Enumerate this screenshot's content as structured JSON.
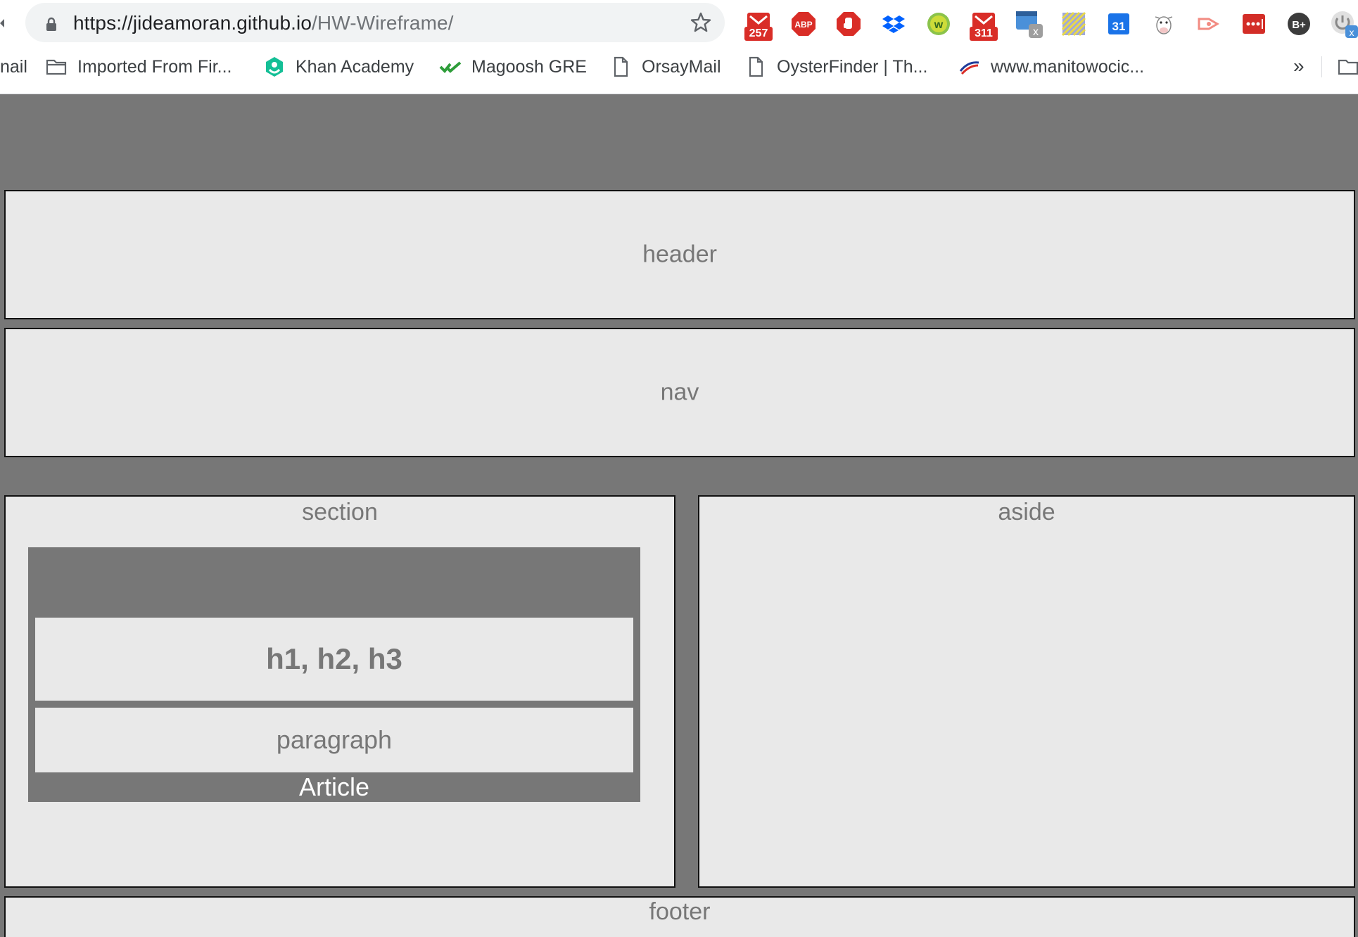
{
  "browser": {
    "url_host": "https://jideamoran.github.io",
    "url_path": "/HW-Wireframe/",
    "back_fragment": "⬅",
    "extensions": [
      {
        "name": "gmail-257",
        "badge": "257"
      },
      {
        "name": "adblock-plus",
        "label": "ABP"
      },
      {
        "name": "adblock-hand",
        "label": ""
      },
      {
        "name": "dropbox",
        "label": ""
      },
      {
        "name": "wordtune-w",
        "label": "w"
      },
      {
        "name": "gmail-311",
        "badge": "311"
      },
      {
        "name": "window-x",
        "label": "x"
      },
      {
        "name": "pattern-ext",
        "label": ""
      },
      {
        "name": "calendar-31",
        "label": "31"
      },
      {
        "name": "cow-ext",
        "label": ""
      },
      {
        "name": "cast-ext",
        "label": ""
      },
      {
        "name": "lastpass",
        "label": "•••|"
      },
      {
        "name": "b-plus",
        "label": "B+"
      },
      {
        "name": "power-x",
        "label": "x"
      }
    ],
    "bookmarks": [
      {
        "label": "nail",
        "icon": "none"
      },
      {
        "label": "Imported From Fir...",
        "icon": "folder-icon"
      },
      {
        "label": "Khan Academy",
        "icon": "khan-icon"
      },
      {
        "label": "Magoosh GRE",
        "icon": "magoosh-icon"
      },
      {
        "label": "OrsayMail",
        "icon": "page-icon"
      },
      {
        "label": "OysterFinder | Th...",
        "icon": "page-icon"
      },
      {
        "label": "www.manitowocic...",
        "icon": "swoosh-icon"
      }
    ],
    "more_label": "»"
  },
  "wireframe": {
    "header_label": "header",
    "nav_label": "nav",
    "section_label": "section",
    "aside_label": "aside",
    "headings_label": "h1, h2, h3",
    "paragraph_label": "paragraph",
    "article_label": "Article",
    "footer_label": "footer"
  },
  "colors": {
    "page_bg": "#777777",
    "box_bg": "#e9e9e9",
    "box_border": "#111111",
    "text": "#777777"
  }
}
